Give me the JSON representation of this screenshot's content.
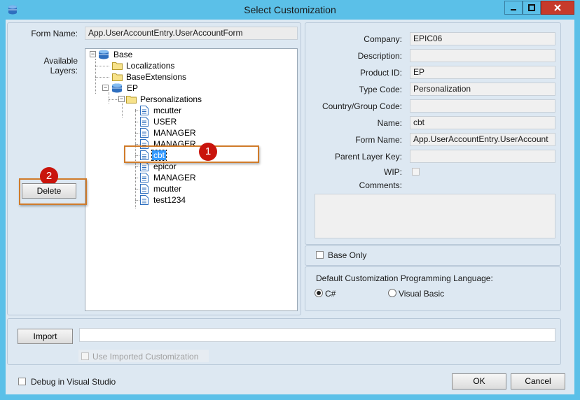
{
  "window": {
    "title": "Select Customization"
  },
  "form_name": {
    "label": "Form Name:",
    "value": "App.UserAccountEntry.UserAccountForm"
  },
  "available_layers_label": "Available\nLayers:",
  "delete_button": "Delete",
  "tree": {
    "base": "Base",
    "localizations": "Localizations",
    "base_extensions": "BaseExtensions",
    "ep": "EP",
    "personalizations": "Personalizations",
    "items": [
      "mcutter",
      "USER",
      "MANAGER",
      "MANAGER",
      "cbt",
      "epicor",
      "MANAGER",
      "mcutter",
      "test1234"
    ],
    "selected_index": 4
  },
  "details": {
    "company": {
      "label": "Company:",
      "value": "EPIC06"
    },
    "description": {
      "label": "Description:",
      "value": ""
    },
    "product_id": {
      "label": "Product ID:",
      "value": "EP"
    },
    "type_code": {
      "label": "Type Code:",
      "value": "Personalization"
    },
    "country_group": {
      "label": "Country/Group Code:",
      "value": ""
    },
    "name": {
      "label": "Name:",
      "value": "cbt"
    },
    "form_name": {
      "label": "Form Name:",
      "value": "App.UserAccountEntry.UserAccount"
    },
    "parent_layer_key": {
      "label": "Parent Layer Key:",
      "value": ""
    },
    "wip": {
      "label": "WIP:",
      "checked": false
    },
    "comments": {
      "label": "Comments:",
      "value": ""
    }
  },
  "base_only": {
    "label": "Base Only",
    "checked": false
  },
  "language": {
    "label": "Default Customization Programming Language:",
    "options": [
      "C#",
      "Visual Basic"
    ],
    "selected": "C#"
  },
  "import": {
    "button": "Import",
    "path": "",
    "use_imported_label": "Use Imported Customization",
    "use_imported_checked": false
  },
  "debug": {
    "label": "Debug in Visual Studio",
    "checked": false
  },
  "ok_button": "OK",
  "cancel_button": "Cancel",
  "annotations": {
    "badge1": "1",
    "badge2": "2"
  },
  "colors": {
    "title_bar": "#5bc0e8",
    "client_bg": "#dde8f2",
    "highlight": "#d07b2a",
    "badge": "#c9140c",
    "selection": "#3399ff"
  }
}
